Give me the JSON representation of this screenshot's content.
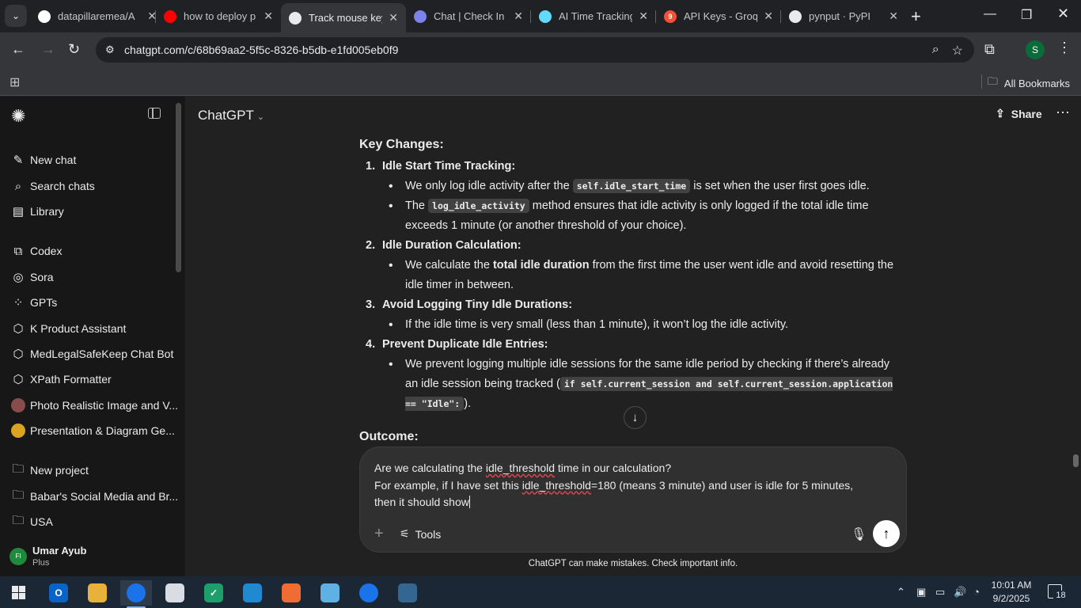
{
  "browser": {
    "tabs": [
      {
        "title": "datapillaremea/A",
        "favicon": "github-icon",
        "color": "#ffffff"
      },
      {
        "title": "how to deploy p",
        "favicon": "youtube-icon",
        "color": "#ff0000"
      },
      {
        "title": "Track mouse key",
        "favicon": "openai-icon",
        "color": "#e8eaed"
      },
      {
        "title": "Chat | Check In |",
        "favicon": "teams-icon",
        "color": "#7b83eb"
      },
      {
        "title": "AI Time Tracking",
        "favicon": "react-icon",
        "color": "#61dafb"
      },
      {
        "title": "API Keys - Groq",
        "favicon": "groq-icon",
        "color": "#f55036",
        "favicon_text": "9"
      },
      {
        "title": "pynput · PyPI",
        "favicon": "pypi-icon",
        "color": "#e8eaed"
      }
    ],
    "active_tab": 2,
    "url": "chatgpt.com/c/68b69aa2-5f5c-8326-b5db-e1fd005eb0f9",
    "profile_initial": "S",
    "bookmarks_label": "All Bookmarks"
  },
  "sidebar": {
    "primary": [
      {
        "label": "New chat",
        "icon": "new-chat-icon"
      },
      {
        "label": "Search chats",
        "icon": "search-icon"
      },
      {
        "label": "Library",
        "icon": "library-icon"
      }
    ],
    "apps": [
      {
        "label": "Codex",
        "icon": "codex-icon"
      },
      {
        "label": "Sora",
        "icon": "sora-icon"
      },
      {
        "label": "GPTs",
        "icon": "gpts-icon"
      },
      {
        "label": "K Product Assistant",
        "icon": "gpt-cube-icon"
      },
      {
        "label": "MedLegalSafeKeep Chat Bot",
        "icon": "gpt-cube-icon"
      },
      {
        "label": "XPath Formatter",
        "icon": "gpt-cube-icon"
      },
      {
        "label": "Photo Realistic Image and V...",
        "icon": "avatar-photo-icon"
      },
      {
        "label": "Presentation & Diagram Ge...",
        "icon": "avatar-diagram-icon"
      }
    ],
    "projects": [
      {
        "label": "New project",
        "icon": "new-project-icon"
      },
      {
        "label": "Babar's Social Media and Br...",
        "icon": "folder-icon"
      },
      {
        "label": "USA",
        "icon": "folder-icon"
      }
    ],
    "user": {
      "name": "Umar Ayub",
      "plan": "Plus",
      "initials": "FI"
    }
  },
  "header": {
    "model": "ChatGPT",
    "share": "Share"
  },
  "message": {
    "heading": "Key Changes:",
    "sections": [
      {
        "num": "1.",
        "title": "Idle Start Time Tracking:",
        "bullets": [
          {
            "parts": [
              {
                "t": "We only log idle activity after the "
              },
              {
                "c": "self.idle_start_time"
              },
              {
                "t": " is set when the user first goes idle."
              }
            ]
          },
          {
            "parts": [
              {
                "t": "The "
              },
              {
                "c": "log_idle_activity"
              },
              {
                "t": " method ensures that idle activity is only logged if the total idle time exceeds 1 minute (or another threshold of your choice)."
              }
            ]
          }
        ]
      },
      {
        "num": "2.",
        "title": "Idle Duration Calculation:",
        "bullets": [
          {
            "parts": [
              {
                "t": "We calculate the "
              },
              {
                "b": "total idle duration"
              },
              {
                "t": " from the first time the user went idle and avoid resetting the idle timer in between."
              }
            ]
          }
        ]
      },
      {
        "num": "3.",
        "title": "Avoid Logging Tiny Idle Durations:",
        "bullets": [
          {
            "parts": [
              {
                "t": "If the idle time is very small (less than 1 minute), it won’t log the idle activity."
              }
            ]
          }
        ]
      },
      {
        "num": "4.",
        "title": "Prevent Duplicate Idle Entries:",
        "bullets": [
          {
            "parts": [
              {
                "t": "We prevent logging multiple idle sessions for the same idle period by checking if there’s already an idle session being tracked ("
              },
              {
                "c": "if self.current_session and self.current_session.application == \"Idle\":"
              },
              {
                "t": ")."
              }
            ]
          }
        ]
      }
    ],
    "outcome_heading": "Outcome:"
  },
  "composer": {
    "lines": [
      [
        {
          "t": "Are we calculating the "
        },
        {
          "s": "idle_threshold"
        },
        {
          "t": " time in our calculation?"
        }
      ],
      [
        {
          "t": "For example, if I have set this "
        },
        {
          "s": "idle_threshold"
        },
        {
          "t": "=180 (means 3 minute) and user is idle for 5 minutes,"
        }
      ],
      [
        {
          "t": "then it should show "
        }
      ]
    ],
    "tools_label": "Tools",
    "disclaimer": "ChatGPT can make mistakes. Check important info."
  },
  "taskbar": {
    "apps": [
      {
        "name": "outlook-icon",
        "label": "O",
        "color": "#0a64c8"
      },
      {
        "name": "file-explorer-icon",
        "label": "",
        "color": "#e8b23a"
      },
      {
        "name": "chrome-icon",
        "label": "",
        "color": "#1a73e8",
        "active": true
      },
      {
        "name": "file-manager-icon",
        "label": "",
        "color": "#d9dde3"
      },
      {
        "name": "check-app-icon",
        "label": "✓",
        "color": "#1e9e6b"
      },
      {
        "name": "vscode-icon",
        "label": "",
        "color": "#1f8ad2"
      },
      {
        "name": "postman-icon",
        "label": "",
        "color": "#ef6c35"
      },
      {
        "name": "notepad-icon",
        "label": "",
        "color": "#5fb0e3"
      },
      {
        "name": "chrome-alt-icon",
        "label": "",
        "color": "#1a73e8"
      },
      {
        "name": "postgres-icon",
        "label": "",
        "color": "#336791"
      }
    ],
    "time": "10:01 AM",
    "date": "9/2/2025",
    "notifications": "18"
  }
}
